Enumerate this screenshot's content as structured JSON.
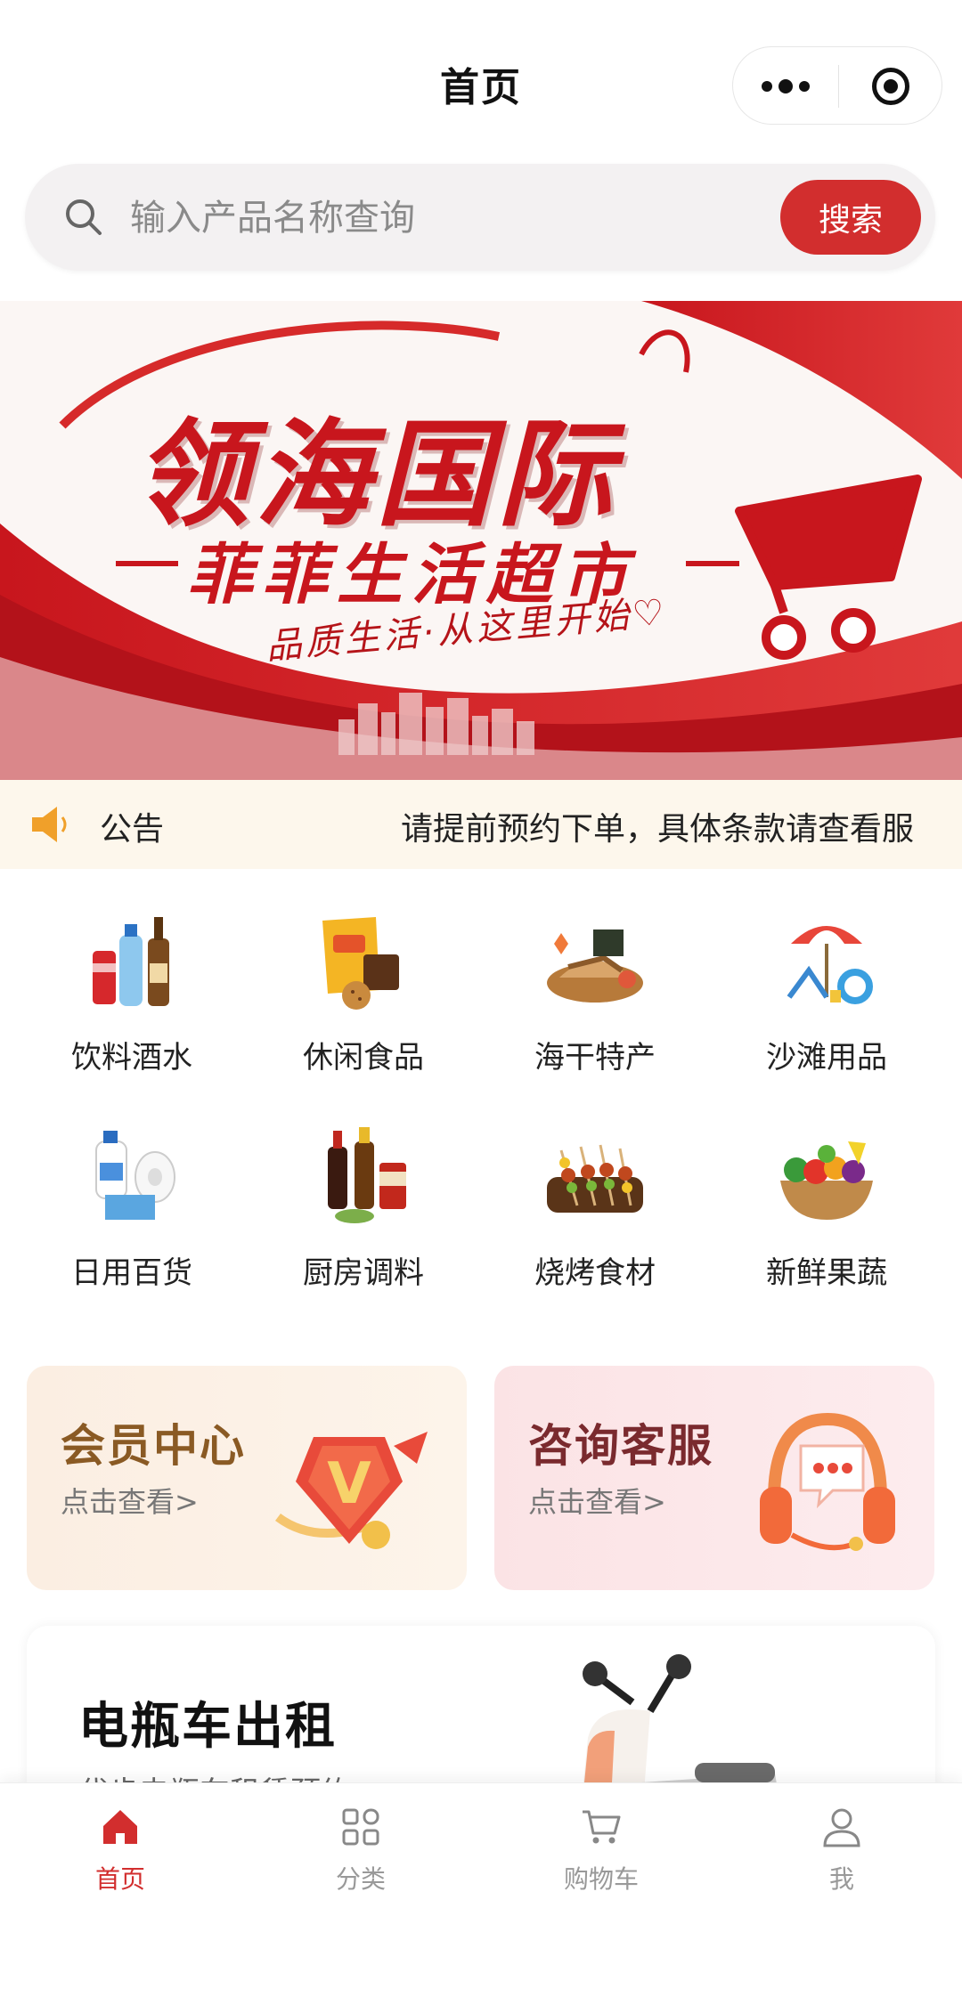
{
  "header": {
    "title": "首页",
    "more_icon": "more-dots-icon",
    "close_icon": "target-circle-icon"
  },
  "search": {
    "placeholder": "输入产品名称查询",
    "value": "",
    "button_label": "搜索",
    "icon": "search-icon"
  },
  "banner": {
    "title": "领海国际",
    "subtitle": "菲菲生活超市",
    "slogan": "品质生活·从这里开始♡",
    "accent_color": "#c8161d"
  },
  "notice": {
    "icon": "speaker-icon",
    "label": "公告",
    "text": "请提前预约下单，具体条款请查看服"
  },
  "categories": [
    {
      "label": "饮料酒水",
      "icon": "drinks-icon"
    },
    {
      "label": "休闲食品",
      "icon": "snacks-icon"
    },
    {
      "label": "海干特产",
      "icon": "dried-seafood-icon"
    },
    {
      "label": "沙滩用品",
      "icon": "beach-gear-icon"
    },
    {
      "label": "日用百货",
      "icon": "daily-goods-icon"
    },
    {
      "label": "厨房调料",
      "icon": "condiments-icon"
    },
    {
      "label": "烧烤食材",
      "icon": "bbq-skewers-icon"
    },
    {
      "label": "新鲜果蔬",
      "icon": "fruit-basket-icon"
    }
  ],
  "promo": {
    "member": {
      "title": "会员中心",
      "link": "点击查看>",
      "icon": "vip-badge-icon"
    },
    "service": {
      "title": "咨询客服",
      "link": "点击查看>",
      "icon": "headset-icon"
    }
  },
  "rental": {
    "title": "电瓶车出租",
    "subtitle": "代步电瓶车租赁预约",
    "icon": "scooter-icon"
  },
  "tabbar": {
    "active_color": "#d22e2e",
    "items": [
      {
        "label": "首页",
        "icon": "home-icon",
        "active": true
      },
      {
        "label": "分类",
        "icon": "category-grid-icon",
        "active": false
      },
      {
        "label": "购物车",
        "icon": "cart-icon",
        "active": false
      },
      {
        "label": "我",
        "icon": "user-icon",
        "active": false
      }
    ]
  }
}
